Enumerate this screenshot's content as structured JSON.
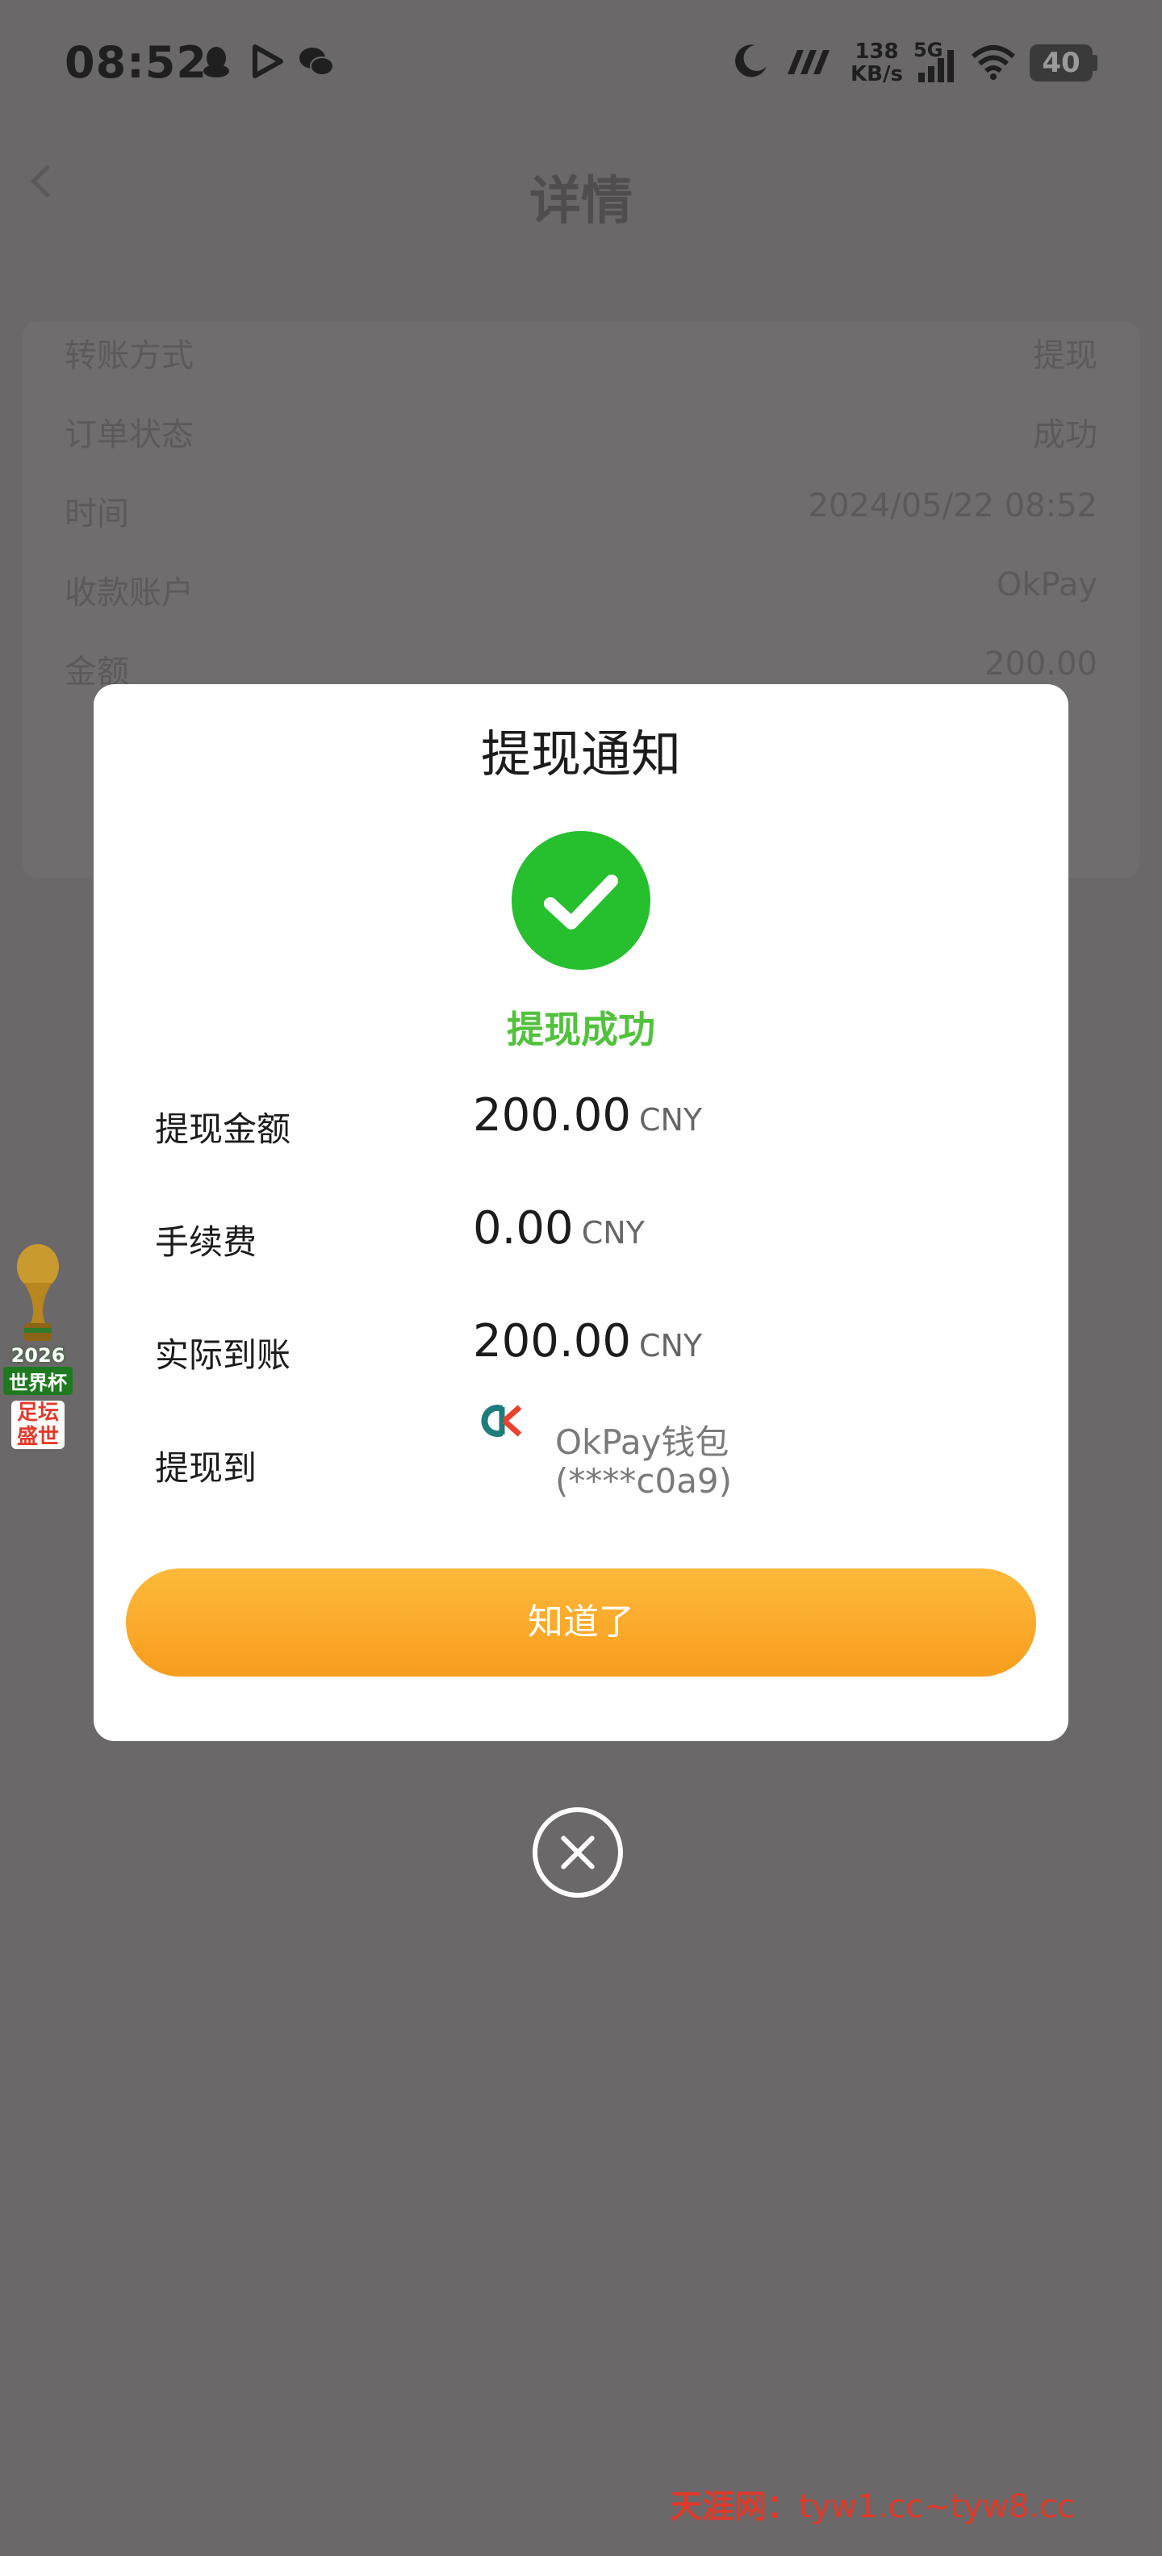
{
  "status_bar": {
    "time": "08:52",
    "net_speed_value": "138",
    "net_speed_unit": "KB/s",
    "network": "5G",
    "battery": "40"
  },
  "background": {
    "title": "详情",
    "rows": [
      {
        "k": "转账方式",
        "v": "提现"
      },
      {
        "k": "订单状态",
        "v": "成功"
      },
      {
        "k": "时间",
        "v": "2024/05/22 08:52"
      },
      {
        "k": "收款账户",
        "v": "OkPay"
      },
      {
        "k": "金额",
        "v": "200.00"
      }
    ]
  },
  "side_badge": {
    "year": "2026",
    "line1": "世界杯",
    "line2": "足坛盛世"
  },
  "modal": {
    "title": "提现通知",
    "success_text": "提现成功",
    "rows": [
      {
        "label": "提现金额",
        "amount": "200.00",
        "currency": "CNY"
      },
      {
        "label": "手续费",
        "amount": "0.00",
        "currency": "CNY"
      },
      {
        "label": "实际到账",
        "amount": "200.00",
        "currency": "CNY"
      }
    ],
    "withdraw_to_label": "提现到",
    "wallet_name": "OkPay钱包",
    "wallet_account": "(****c0a9)",
    "confirm_button": "知道了"
  },
  "watermark": {
    "label": "天涯网：",
    "text": "tyw1.cc~tyw8.cc"
  },
  "colors": {
    "success_green": "#26bf2e",
    "button_orange": "#f89d1d",
    "overlay": "#6a6869"
  }
}
